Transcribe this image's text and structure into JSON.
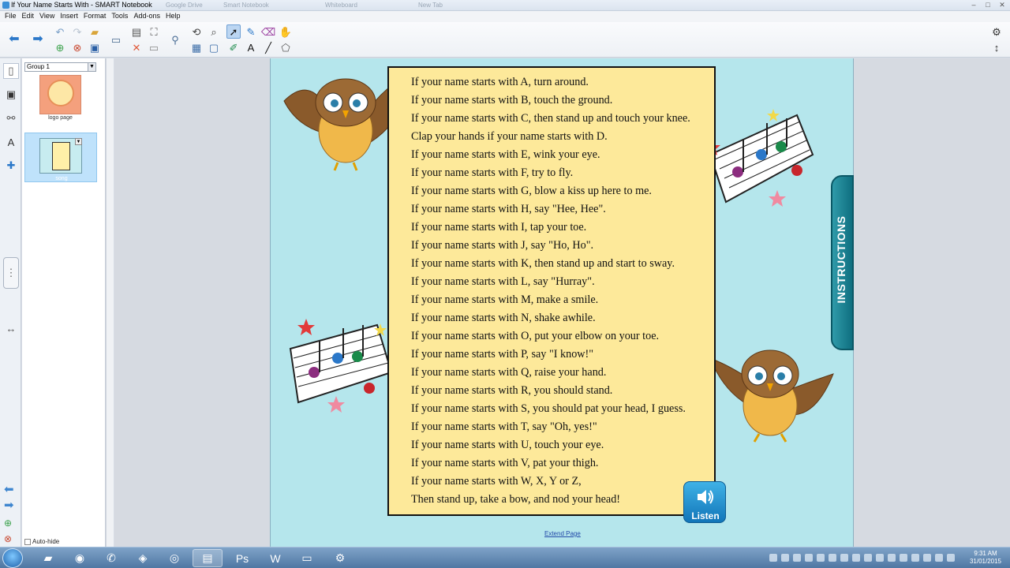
{
  "window": {
    "title": "If Your Name Starts With - SMART Notebook",
    "background_tabs": [
      "Google Drive",
      "Smart Notebook",
      "Whiteboard",
      "New Tab"
    ]
  },
  "menu": [
    "File",
    "Edit",
    "View",
    "Insert",
    "Format",
    "Tools",
    "Add-ons",
    "Help"
  ],
  "sorter": {
    "group": "Group 1",
    "pages": [
      {
        "label": "logo page"
      },
      {
        "label": "song"
      }
    ],
    "autohide_label": "Auto-hide"
  },
  "song": {
    "lines": [
      "If your name starts with A, turn around.",
      "If your name starts with B, touch the ground.",
      "If your name starts with C, then stand up and touch your knee.",
      "Clap your hands if your name starts with D.",
      "If your name starts with E, wink your eye.",
      "If your name starts with F, try to fly.",
      "If your name starts with G, blow a kiss up here to me.",
      "If your name starts with H, say \"Hee, Hee\".",
      "If your name starts with I, tap your toe.",
      "If your name starts with J, say \"Ho, Ho\".",
      "If your name starts with K, then stand up and start to sway.",
      "If your name starts with L, say \"Hurray\".",
      "If your name starts with M, make a smile.",
      "If your name starts with N, shake awhile.",
      "If your name starts with O, put your elbow on your toe.",
      "If your name starts with P, say \"I know!\"",
      "If your name starts with Q, raise your hand.",
      "If your name starts with R, you should stand.",
      "If your name starts with S, you should pat your head, I guess.",
      "If your name starts with T, say \"Oh, yes!\"",
      "If your name starts with U, touch your eye.",
      "If your name starts with V, pat your thigh.",
      "If your name starts with W, X, Y or Z,",
      "Then stand up, take a bow, and nod your head!"
    ]
  },
  "listen_label": "Listen",
  "instructions_label": "INSTRUCTIONS",
  "extend_label": "Extend Page",
  "taskbar": {
    "time": "9:31 AM",
    "date": "31/01/2015"
  },
  "colors": {
    "page_bg": "#b5e6ec",
    "song_paper": "#fde99a",
    "listen_button": "#1d8fd0",
    "instructions_tab": "#1f8595"
  }
}
